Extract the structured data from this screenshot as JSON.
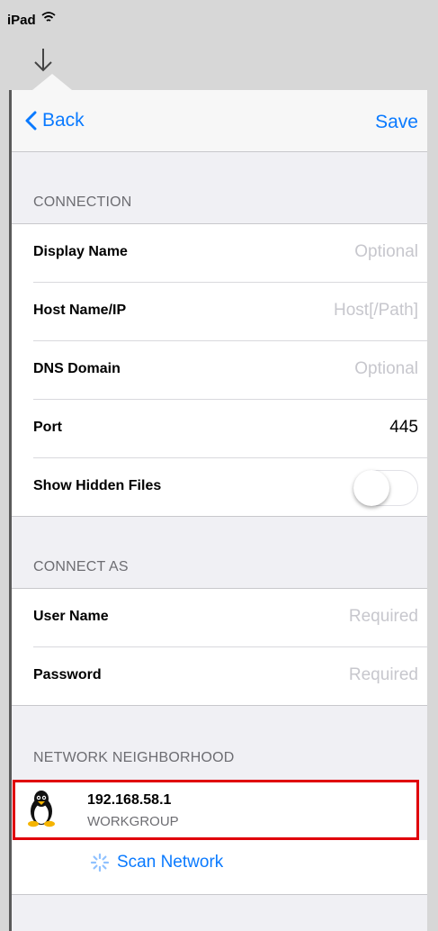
{
  "status": {
    "carrier": "iPad"
  },
  "nav": {
    "back_label": "Back",
    "save_label": "Save"
  },
  "connection": {
    "header": "CONNECTION",
    "display_name": {
      "label": "Display Name",
      "placeholder": "Optional"
    },
    "host": {
      "label": "Host Name/IP",
      "placeholder": "Host[/Path]"
    },
    "dns": {
      "label": "DNS Domain",
      "placeholder": "Optional"
    },
    "port": {
      "label": "Port",
      "value": "445"
    },
    "hidden": {
      "label": "Show Hidden Files",
      "on": false
    }
  },
  "connect_as": {
    "header": "CONNECT AS",
    "user": {
      "label": "User Name",
      "placeholder": "Required"
    },
    "password": {
      "label": "Password",
      "placeholder": "Required"
    }
  },
  "neighborhood": {
    "header": "NETWORK NEIGHBORHOOD",
    "items": [
      {
        "ip": "192.168.58.1",
        "workgroup": "WORKGROUP",
        "icon": "linux-tux-icon"
      }
    ],
    "scan_label": "Scan Network"
  },
  "colors": {
    "accent": "#0a7aff",
    "highlight": "#e0000a"
  }
}
